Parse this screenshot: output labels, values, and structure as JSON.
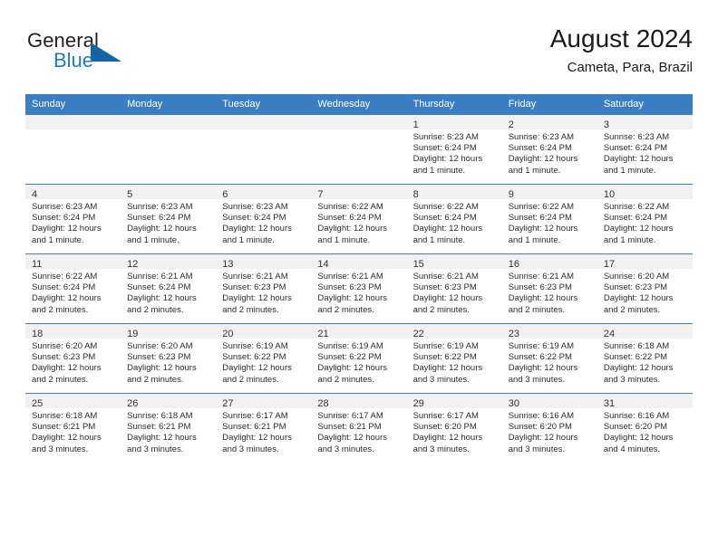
{
  "brand": {
    "word1": "General",
    "word2": "Blue",
    "triangle_color": "#1464a5",
    "blue_color": "#1f7ac0"
  },
  "header": {
    "title": "August 2024",
    "location": "Cameta, Para, Brazil"
  },
  "theme": {
    "header_row_bg": "#3a7fc1",
    "daynum_band_bg": "#f1f1f1",
    "grid_line": "#3a7fc1"
  },
  "weekdays": [
    "Sunday",
    "Monday",
    "Tuesday",
    "Wednesday",
    "Thursday",
    "Friday",
    "Saturday"
  ],
  "weeks": [
    [
      {
        "day": "",
        "empty": true
      },
      {
        "day": "",
        "empty": true
      },
      {
        "day": "",
        "empty": true
      },
      {
        "day": "",
        "empty": true
      },
      {
        "day": "1",
        "sunrise": "Sunrise: 6:23 AM",
        "sunset": "Sunset: 6:24 PM",
        "daylight1": "Daylight: 12 hours",
        "daylight2": "and 1 minute."
      },
      {
        "day": "2",
        "sunrise": "Sunrise: 6:23 AM",
        "sunset": "Sunset: 6:24 PM",
        "daylight1": "Daylight: 12 hours",
        "daylight2": "and 1 minute."
      },
      {
        "day": "3",
        "sunrise": "Sunrise: 6:23 AM",
        "sunset": "Sunset: 6:24 PM",
        "daylight1": "Daylight: 12 hours",
        "daylight2": "and 1 minute."
      }
    ],
    [
      {
        "day": "4",
        "sunrise": "Sunrise: 6:23 AM",
        "sunset": "Sunset: 6:24 PM",
        "daylight1": "Daylight: 12 hours",
        "daylight2": "and 1 minute."
      },
      {
        "day": "5",
        "sunrise": "Sunrise: 6:23 AM",
        "sunset": "Sunset: 6:24 PM",
        "daylight1": "Daylight: 12 hours",
        "daylight2": "and 1 minute."
      },
      {
        "day": "6",
        "sunrise": "Sunrise: 6:23 AM",
        "sunset": "Sunset: 6:24 PM",
        "daylight1": "Daylight: 12 hours",
        "daylight2": "and 1 minute."
      },
      {
        "day": "7",
        "sunrise": "Sunrise: 6:22 AM",
        "sunset": "Sunset: 6:24 PM",
        "daylight1": "Daylight: 12 hours",
        "daylight2": "and 1 minute."
      },
      {
        "day": "8",
        "sunrise": "Sunrise: 6:22 AM",
        "sunset": "Sunset: 6:24 PM",
        "daylight1": "Daylight: 12 hours",
        "daylight2": "and 1 minute."
      },
      {
        "day": "9",
        "sunrise": "Sunrise: 6:22 AM",
        "sunset": "Sunset: 6:24 PM",
        "daylight1": "Daylight: 12 hours",
        "daylight2": "and 1 minute."
      },
      {
        "day": "10",
        "sunrise": "Sunrise: 6:22 AM",
        "sunset": "Sunset: 6:24 PM",
        "daylight1": "Daylight: 12 hours",
        "daylight2": "and 1 minute."
      }
    ],
    [
      {
        "day": "11",
        "sunrise": "Sunrise: 6:22 AM",
        "sunset": "Sunset: 6:24 PM",
        "daylight1": "Daylight: 12 hours",
        "daylight2": "and 2 minutes."
      },
      {
        "day": "12",
        "sunrise": "Sunrise: 6:21 AM",
        "sunset": "Sunset: 6:24 PM",
        "daylight1": "Daylight: 12 hours",
        "daylight2": "and 2 minutes."
      },
      {
        "day": "13",
        "sunrise": "Sunrise: 6:21 AM",
        "sunset": "Sunset: 6:23 PM",
        "daylight1": "Daylight: 12 hours",
        "daylight2": "and 2 minutes."
      },
      {
        "day": "14",
        "sunrise": "Sunrise: 6:21 AM",
        "sunset": "Sunset: 6:23 PM",
        "daylight1": "Daylight: 12 hours",
        "daylight2": "and 2 minutes."
      },
      {
        "day": "15",
        "sunrise": "Sunrise: 6:21 AM",
        "sunset": "Sunset: 6:23 PM",
        "daylight1": "Daylight: 12 hours",
        "daylight2": "and 2 minutes."
      },
      {
        "day": "16",
        "sunrise": "Sunrise: 6:21 AM",
        "sunset": "Sunset: 6:23 PM",
        "daylight1": "Daylight: 12 hours",
        "daylight2": "and 2 minutes."
      },
      {
        "day": "17",
        "sunrise": "Sunrise: 6:20 AM",
        "sunset": "Sunset: 6:23 PM",
        "daylight1": "Daylight: 12 hours",
        "daylight2": "and 2 minutes."
      }
    ],
    [
      {
        "day": "18",
        "sunrise": "Sunrise: 6:20 AM",
        "sunset": "Sunset: 6:23 PM",
        "daylight1": "Daylight: 12 hours",
        "daylight2": "and 2 minutes."
      },
      {
        "day": "19",
        "sunrise": "Sunrise: 6:20 AM",
        "sunset": "Sunset: 6:23 PM",
        "daylight1": "Daylight: 12 hours",
        "daylight2": "and 2 minutes."
      },
      {
        "day": "20",
        "sunrise": "Sunrise: 6:19 AM",
        "sunset": "Sunset: 6:22 PM",
        "daylight1": "Daylight: 12 hours",
        "daylight2": "and 2 minutes."
      },
      {
        "day": "21",
        "sunrise": "Sunrise: 6:19 AM",
        "sunset": "Sunset: 6:22 PM",
        "daylight1": "Daylight: 12 hours",
        "daylight2": "and 2 minutes."
      },
      {
        "day": "22",
        "sunrise": "Sunrise: 6:19 AM",
        "sunset": "Sunset: 6:22 PM",
        "daylight1": "Daylight: 12 hours",
        "daylight2": "and 3 minutes."
      },
      {
        "day": "23",
        "sunrise": "Sunrise: 6:19 AM",
        "sunset": "Sunset: 6:22 PM",
        "daylight1": "Daylight: 12 hours",
        "daylight2": "and 3 minutes."
      },
      {
        "day": "24",
        "sunrise": "Sunrise: 6:18 AM",
        "sunset": "Sunset: 6:22 PM",
        "daylight1": "Daylight: 12 hours",
        "daylight2": "and 3 minutes."
      }
    ],
    [
      {
        "day": "25",
        "sunrise": "Sunrise: 6:18 AM",
        "sunset": "Sunset: 6:21 PM",
        "daylight1": "Daylight: 12 hours",
        "daylight2": "and 3 minutes."
      },
      {
        "day": "26",
        "sunrise": "Sunrise: 6:18 AM",
        "sunset": "Sunset: 6:21 PM",
        "daylight1": "Daylight: 12 hours",
        "daylight2": "and 3 minutes."
      },
      {
        "day": "27",
        "sunrise": "Sunrise: 6:17 AM",
        "sunset": "Sunset: 6:21 PM",
        "daylight1": "Daylight: 12 hours",
        "daylight2": "and 3 minutes."
      },
      {
        "day": "28",
        "sunrise": "Sunrise: 6:17 AM",
        "sunset": "Sunset: 6:21 PM",
        "daylight1": "Daylight: 12 hours",
        "daylight2": "and 3 minutes."
      },
      {
        "day": "29",
        "sunrise": "Sunrise: 6:17 AM",
        "sunset": "Sunset: 6:20 PM",
        "daylight1": "Daylight: 12 hours",
        "daylight2": "and 3 minutes."
      },
      {
        "day": "30",
        "sunrise": "Sunrise: 6:16 AM",
        "sunset": "Sunset: 6:20 PM",
        "daylight1": "Daylight: 12 hours",
        "daylight2": "and 3 minutes."
      },
      {
        "day": "31",
        "sunrise": "Sunrise: 6:16 AM",
        "sunset": "Sunset: 6:20 PM",
        "daylight1": "Daylight: 12 hours",
        "daylight2": "and 4 minutes."
      }
    ]
  ]
}
